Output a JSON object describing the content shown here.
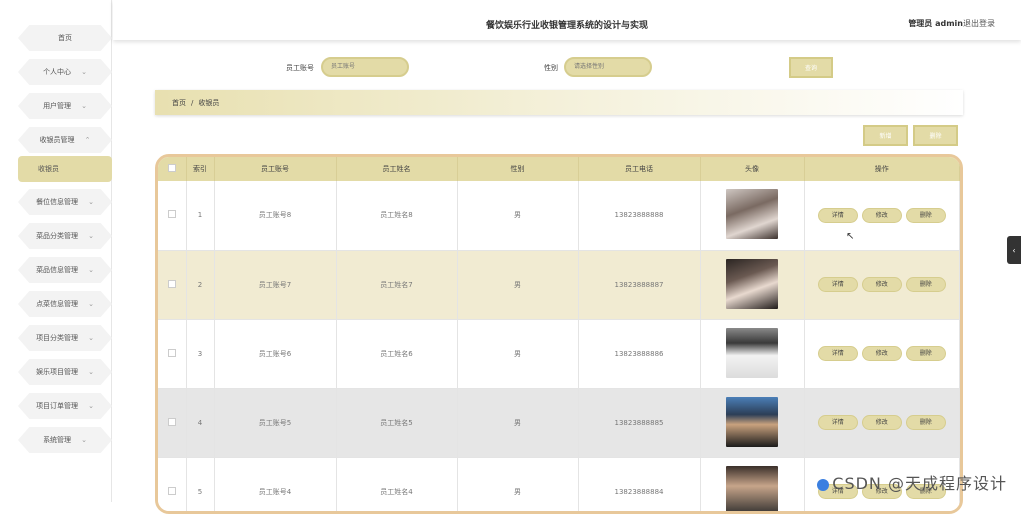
{
  "header": {
    "title": "餐饮娱乐行业收银管理系统的设计与实现",
    "admin_label": "管理员 admin",
    "logout_label": "退出登录"
  },
  "sidebar": {
    "items": [
      {
        "label": "首页",
        "chevron": ""
      },
      {
        "label": "个人中心",
        "chevron": "⌄"
      },
      {
        "label": "用户管理",
        "chevron": "⌄"
      },
      {
        "label": "收银员管理",
        "chevron": "⌃"
      },
      {
        "label": "收银员",
        "chevron": ""
      },
      {
        "label": "餐位信息管理",
        "chevron": "⌄"
      },
      {
        "label": "菜品分类管理",
        "chevron": "⌄"
      },
      {
        "label": "菜品信息管理",
        "chevron": "⌄"
      },
      {
        "label": "点菜信息管理",
        "chevron": "⌄"
      },
      {
        "label": "项目分类管理",
        "chevron": "⌄"
      },
      {
        "label": "娱乐项目管理",
        "chevron": "⌄"
      },
      {
        "label": "项目订单管理",
        "chevron": "⌄"
      },
      {
        "label": "系统管理",
        "chevron": "⌄"
      }
    ]
  },
  "search": {
    "account_label": "员工账号",
    "account_placeholder": "员工账号",
    "gender_label": "性别",
    "gender_placeholder": "请选择性别",
    "query_button": "查询"
  },
  "breadcrumb": {
    "home": "首页",
    "separator": "/",
    "current": "收银员"
  },
  "actions": {
    "add_button": "新增",
    "delete_button": "删除"
  },
  "table": {
    "headers": {
      "index": "索引",
      "account": "员工账号",
      "name": "员工姓名",
      "gender": "性别",
      "phone": "员工电话",
      "avatar": "头像",
      "ops": "操作"
    },
    "rows": [
      {
        "index": "1",
        "account": "员工账号8",
        "name": "员工姓名8",
        "gender": "男",
        "phone": "13823888888"
      },
      {
        "index": "2",
        "account": "员工账号7",
        "name": "员工姓名7",
        "gender": "男",
        "phone": "13823888887"
      },
      {
        "index": "3",
        "account": "员工账号6",
        "name": "员工姓名6",
        "gender": "男",
        "phone": "13823888886"
      },
      {
        "index": "4",
        "account": "员工账号5",
        "name": "员工姓名5",
        "gender": "男",
        "phone": "13823888885"
      },
      {
        "index": "5",
        "account": "员工账号4",
        "name": "员工姓名4",
        "gender": "男",
        "phone": "13823888884"
      }
    ],
    "op_labels": {
      "detail": "详情",
      "edit": "修改",
      "delete": "删除"
    }
  },
  "watermark": "CSDN @天成程序设计",
  "colors": {
    "accent": "#e3dba7",
    "table_border": "#e8c89a"
  }
}
